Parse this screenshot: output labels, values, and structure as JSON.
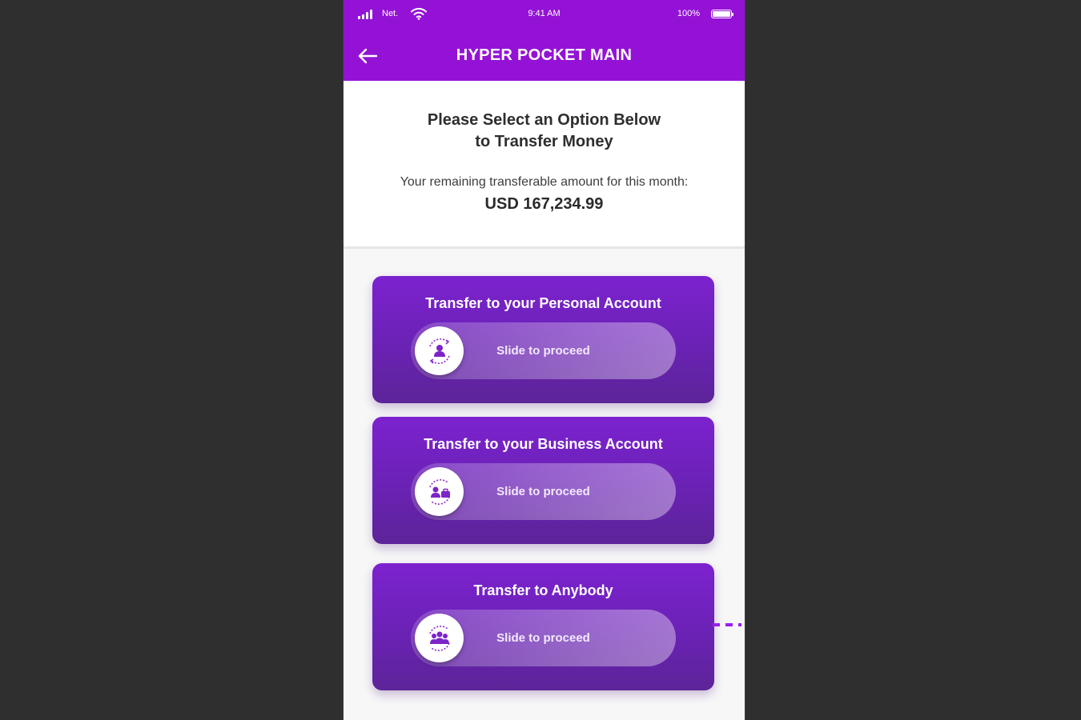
{
  "status_bar": {
    "carrier": "Net.",
    "time": "9:41 AM",
    "battery": "100%"
  },
  "app_bar": {
    "title": "HYPER POCKET MAIN",
    "back_icon": "arrow-left-icon"
  },
  "info": {
    "headline_line1": "Please Select an Option Below",
    "headline_line2": "to Transfer Money",
    "remaining_label": "Your remaining transferable amount for this month:",
    "amount": "USD 167,234.99"
  },
  "options": [
    {
      "title": "Transfer to your Personal Account",
      "slider_label": "Slide to proceed",
      "icon": "person-transfer-icon"
    },
    {
      "title": "Transfer to your Business Account",
      "slider_label": "Slide to proceed",
      "icon": "business-transfer-icon"
    },
    {
      "title": "Transfer to Anybody",
      "slider_label": "Slide to proceed",
      "icon": "group-transfer-icon"
    }
  ],
  "colors": {
    "brand_purple": "#9412d6",
    "card_purple": "#6a22b4"
  }
}
